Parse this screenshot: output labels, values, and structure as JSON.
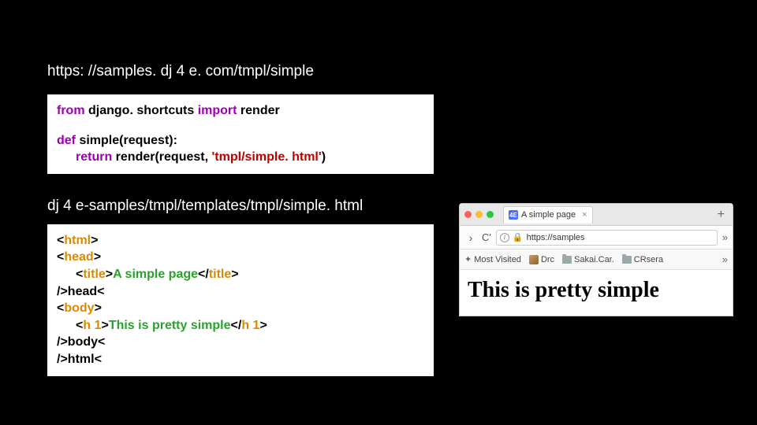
{
  "heading_url": "https: //samples. dj 4 e. com/tmpl/simple",
  "python": {
    "line1": {
      "from": "from",
      "mod": " django. shortcuts ",
      "import": "import",
      "name": " render"
    },
    "line2": {
      "def": "def",
      "fn": " simple",
      "args": "(request):"
    },
    "line3": {
      "ret": "return",
      "call": " render(request, ",
      "str": "'tmpl/simple. html'",
      "close": ")"
    }
  },
  "file_path": "dj 4 e-samples/tmpl/templates/tmpl/simple. html",
  "html_sample": {
    "l1a": "<",
    "l1b": "html",
    "l1c": ">",
    "l2a": "<",
    "l2b": "head",
    "l2c": ">",
    "l3a": "<",
    "l3b": "title",
    "l3c": ">",
    "l3txt": "A simple page",
    "l3d": "</",
    "l3e": "title",
    "l3f": ">",
    "l4": "/>head<",
    "l5a": "<",
    "l5b": "body",
    "l5c": ">",
    "l6a": "<",
    "l6b": "h 1",
    "l6c": ">",
    "l6txt": "This is pretty simple",
    "l6d": "</",
    "l6e": "h 1",
    "l6f": ">",
    "l7": "/>body<",
    "l8": "/>html<"
  },
  "browser": {
    "favicon": "4E",
    "tab_title": "A simple page",
    "plus": "+",
    "nav_right": "›",
    "reload": "C'",
    "info": "i",
    "addr": "https://samples",
    "chev": "»",
    "bookmarks": {
      "b1": "Most Visited",
      "b2": "Drc",
      "b3": "Sakai.Car.",
      "b4": "CRsera"
    },
    "page_h1": "This is pretty simple"
  }
}
